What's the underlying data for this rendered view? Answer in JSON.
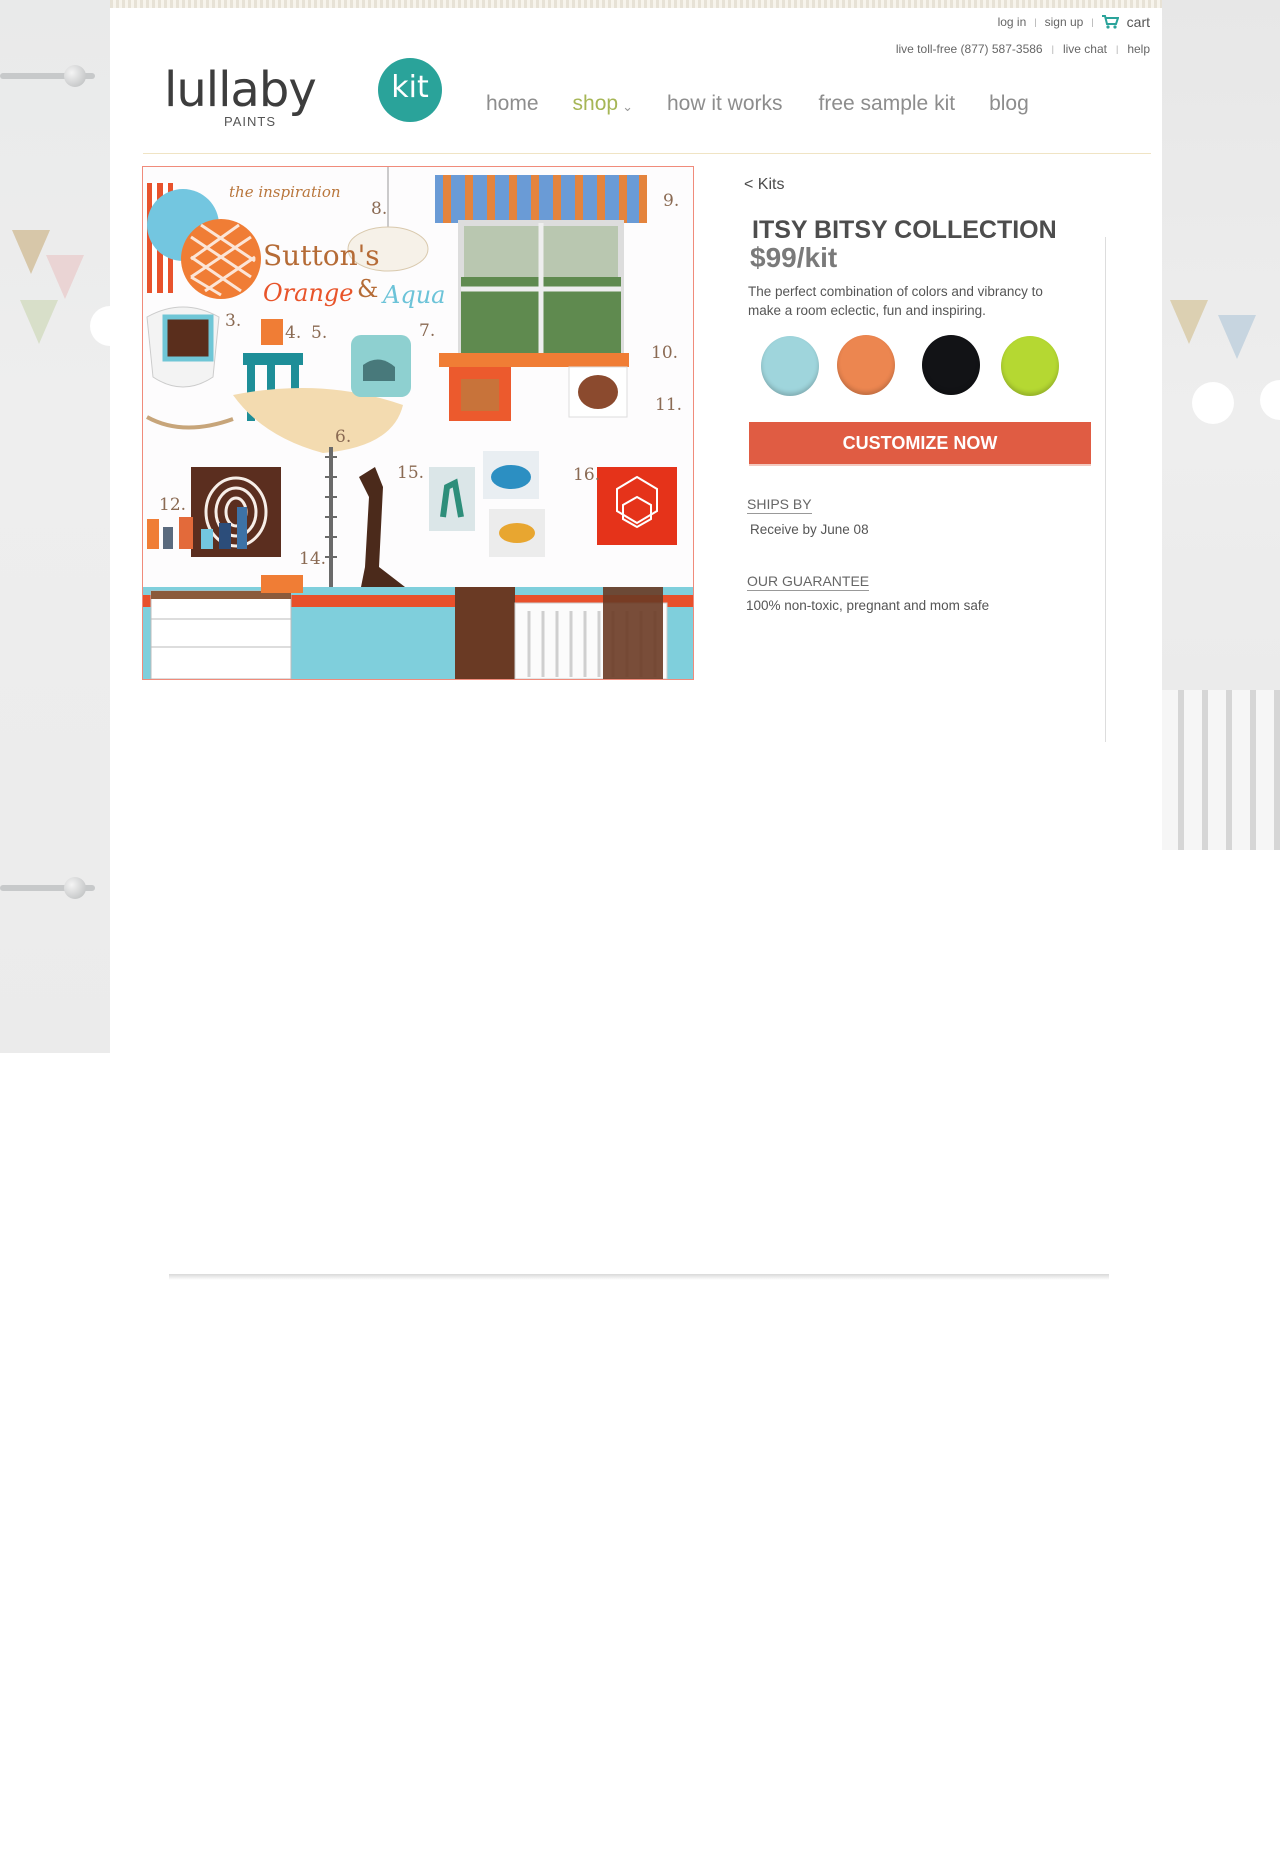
{
  "utility": {
    "log_in": "log in",
    "sign_up": "sign up",
    "cart": "cart",
    "sep": "|",
    "toll_free": "live toll-free (877) 587-3586",
    "live_chat": "live chat",
    "help": "help"
  },
  "logo": {
    "word": "lullaby",
    "sub": "PAINTS",
    "kit": "kit"
  },
  "nav": {
    "items": [
      {
        "label": "home"
      },
      {
        "label": "shop"
      },
      {
        "label": "how it works"
      },
      {
        "label": "free sample kit"
      },
      {
        "label": "blog"
      }
    ],
    "caret": "⌄"
  },
  "product_image": {
    "caption_top": "the inspiration",
    "title_1": "Sutton's",
    "title_2": "Orange",
    "amp": "&",
    "title_3": "Aqua",
    "numbers": [
      "3.",
      "4.",
      "5.",
      "6.",
      "7.",
      "8.",
      "9.",
      "10.",
      "11.",
      "12.",
      "14.",
      "15.",
      "16."
    ]
  },
  "product": {
    "back": "< Kits",
    "title": "ITSY BITSY COLLECTION",
    "price": "$99/kit",
    "description": "The perfect combination of colors and vibrancy to make a room eclectic, fun and inspiring.",
    "swatches": [
      "#9fd5dc",
      "#ec8650",
      "#121316",
      "#b5d832"
    ],
    "cta": "CUSTOMIZE NOW",
    "ships_heading": "SHIPS BY",
    "ships_text": "Receive by June 08",
    "guarantee_heading": "OUR GUARANTEE",
    "guarantee_text": "100% non-toxic, pregnant and mom safe"
  }
}
